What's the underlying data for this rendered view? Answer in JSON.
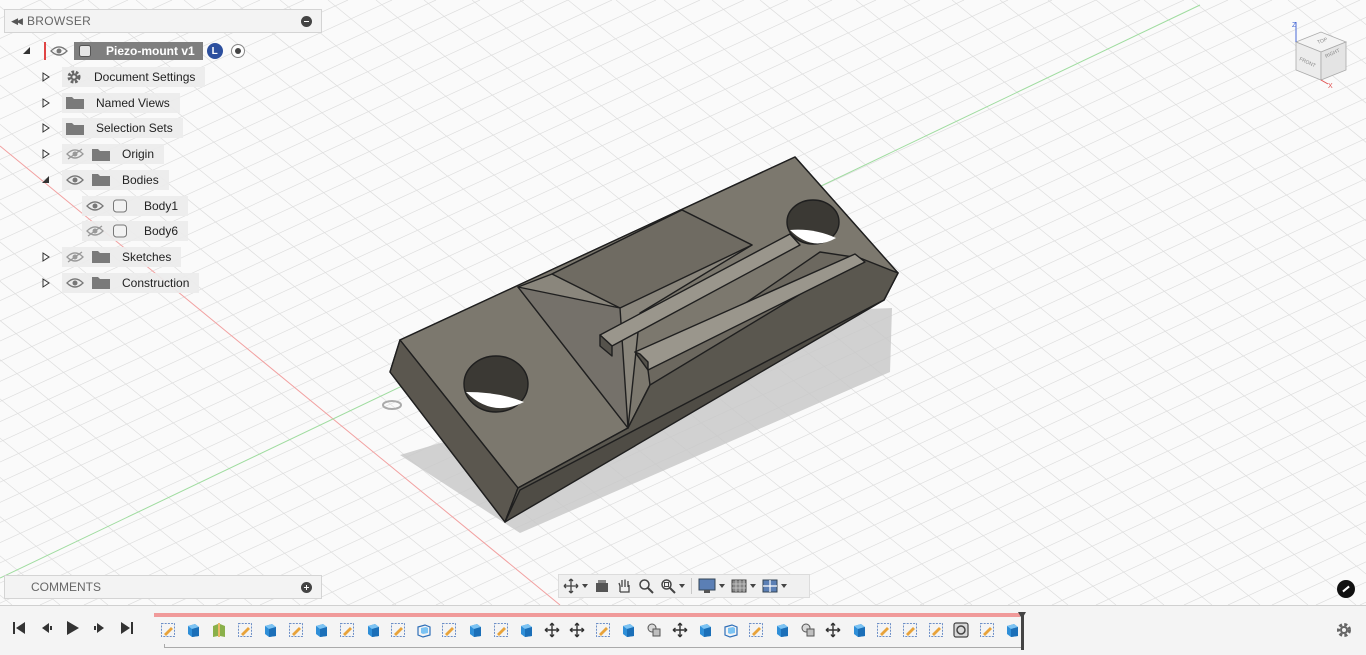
{
  "browser": {
    "title": "BROWSER",
    "root": {
      "label": "Piezo-mount v1",
      "badge": "L"
    },
    "items": [
      {
        "label": "Document Settings",
        "icon": "gear-icon",
        "expanded": false,
        "visible": null
      },
      {
        "label": "Named Views",
        "icon": "folder-icon",
        "expanded": false,
        "visible": null
      },
      {
        "label": "Selection Sets",
        "icon": "folder-icon",
        "expanded": false,
        "visible": null
      },
      {
        "label": "Origin",
        "icon": "folder-icon",
        "expanded": false,
        "visible": false
      },
      {
        "label": "Bodies",
        "icon": "folder-icon",
        "expanded": true,
        "visible": true
      },
      {
        "label": "Body1",
        "icon": "body-icon",
        "expanded": null,
        "visible": true,
        "child": true
      },
      {
        "label": "Body6",
        "icon": "body-icon",
        "expanded": null,
        "visible": false,
        "child": true
      },
      {
        "label": "Sketches",
        "icon": "folder-icon",
        "expanded": false,
        "visible": false
      },
      {
        "label": "Construction",
        "icon": "folder-icon",
        "expanded": false,
        "visible": true
      }
    ]
  },
  "comments": {
    "title": "COMMENTS"
  },
  "viewcube": {
    "top": "TOP",
    "front": "FRONT",
    "right": "RIGHT",
    "axis_z": "Z",
    "axis_x": "X"
  },
  "navbar": {
    "tools": [
      "orbit-icon",
      "look-at-icon",
      "pan-icon",
      "zoom-icon",
      "fit-icon",
      "display-settings-icon",
      "grid-icon",
      "viewports-icon"
    ]
  },
  "timeline": {
    "playback": [
      "first-step-icon",
      "previous-step-icon",
      "play-icon",
      "next-step-icon",
      "last-step-icon"
    ],
    "features": [
      "sketch",
      "extrude",
      "split",
      "sketch",
      "extrude",
      "sketch",
      "extrude",
      "sketch",
      "extrude",
      "sketch",
      "box",
      "sketch",
      "extrude",
      "sketch",
      "extrude",
      "move",
      "move",
      "sketch",
      "extrude",
      "combine",
      "move",
      "extrude",
      "box",
      "sketch",
      "extrude",
      "combine",
      "move",
      "extrude",
      "sketch",
      "sketch",
      "sketch",
      "section",
      "sketch",
      "extrude"
    ]
  },
  "colors": {
    "accent": "#2c4f9e",
    "timeline_red": "#f09a9a",
    "body_gray": "#6f6b62"
  }
}
